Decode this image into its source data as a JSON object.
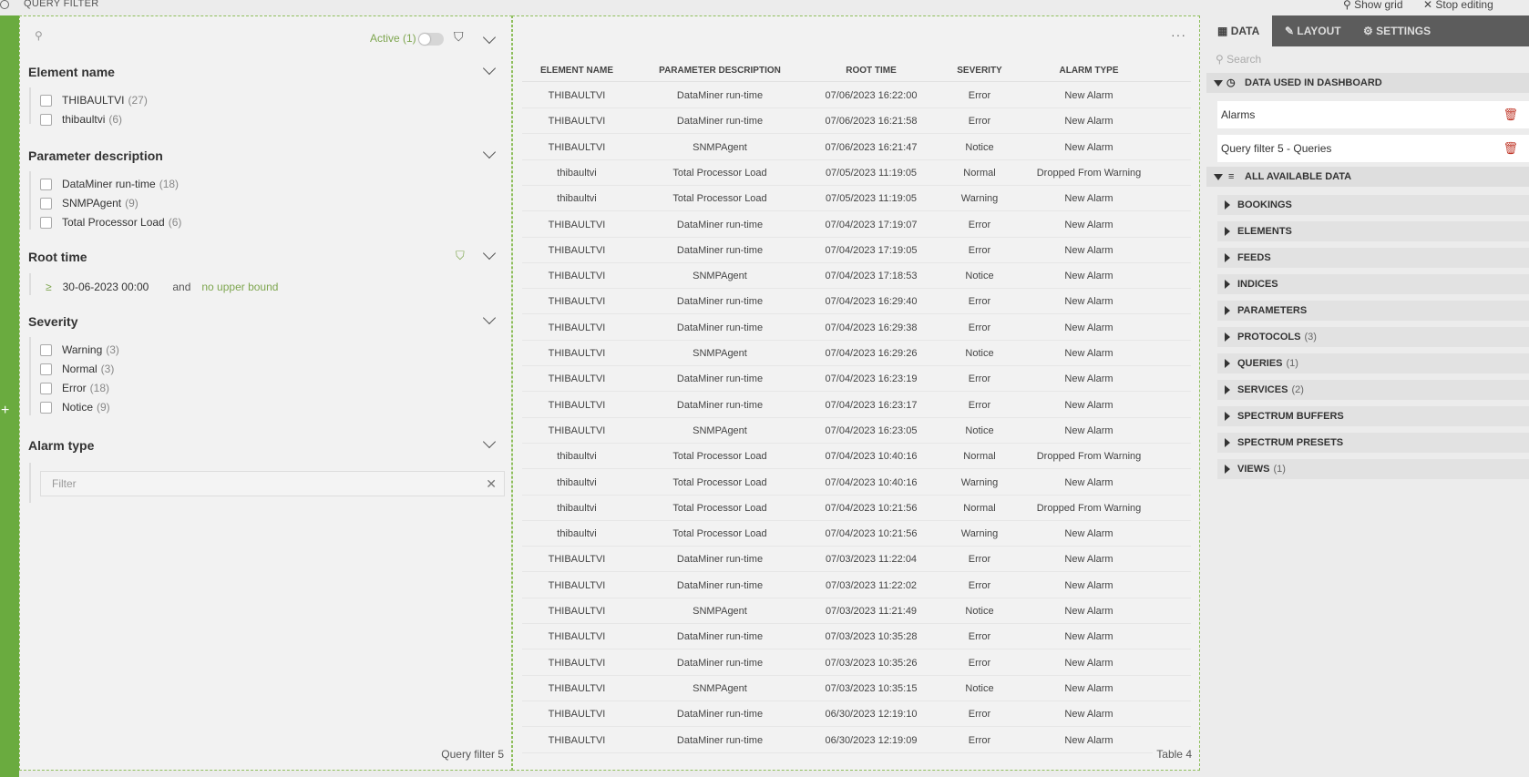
{
  "topbar": {
    "title": "QUERY FILTER",
    "show_grid": "Show grid",
    "stop_editing": "Stop editing"
  },
  "query_filter": {
    "active_label": "Active (1)",
    "sections": {
      "element_name": {
        "title": "Element name",
        "options": [
          {
            "label": "THIBAULTVI",
            "count": "(27)"
          },
          {
            "label": "thibaultvi",
            "count": "(6)"
          }
        ]
      },
      "parameter_description": {
        "title": "Parameter description",
        "options": [
          {
            "label": "DataMiner run-time",
            "count": "(18)"
          },
          {
            "label": "SNMPAgent",
            "count": "(9)"
          },
          {
            "label": "Total Processor Load",
            "count": "(6)"
          }
        ]
      },
      "root_time": {
        "title": "Root time",
        "operator": "≥",
        "lower": "30-06-2023 00:00",
        "and": "and",
        "upper": "no upper bound"
      },
      "severity": {
        "title": "Severity",
        "options": [
          {
            "label": "Warning",
            "count": "(3)"
          },
          {
            "label": "Normal",
            "count": "(3)"
          },
          {
            "label": "Error",
            "count": "(18)"
          },
          {
            "label": "Notice",
            "count": "(9)"
          }
        ]
      },
      "alarm_type": {
        "title": "Alarm type",
        "filter_placeholder": "Filter"
      }
    },
    "component_label": "Query filter 5"
  },
  "table": {
    "headers": [
      "ELEMENT NAME",
      "PARAMETER DESCRIPTION",
      "ROOT TIME",
      "SEVERITY",
      "ALARM TYPE"
    ],
    "rows": [
      [
        "THIBAULTVI",
        "DataMiner run-time",
        "07/06/2023 16:22:00",
        "Error",
        "New Alarm"
      ],
      [
        "THIBAULTVI",
        "DataMiner run-time",
        "07/06/2023 16:21:58",
        "Error",
        "New Alarm"
      ],
      [
        "THIBAULTVI",
        "SNMPAgent",
        "07/06/2023 16:21:47",
        "Notice",
        "New Alarm"
      ],
      [
        "thibaultvi",
        "Total Processor Load",
        "07/05/2023 11:19:05",
        "Normal",
        "Dropped From Warning"
      ],
      [
        "thibaultvi",
        "Total Processor Load",
        "07/05/2023 11:19:05",
        "Warning",
        "New Alarm"
      ],
      [
        "THIBAULTVI",
        "DataMiner run-time",
        "07/04/2023 17:19:07",
        "Error",
        "New Alarm"
      ],
      [
        "THIBAULTVI",
        "DataMiner run-time",
        "07/04/2023 17:19:05",
        "Error",
        "New Alarm"
      ],
      [
        "THIBAULTVI",
        "SNMPAgent",
        "07/04/2023 17:18:53",
        "Notice",
        "New Alarm"
      ],
      [
        "THIBAULTVI",
        "DataMiner run-time",
        "07/04/2023 16:29:40",
        "Error",
        "New Alarm"
      ],
      [
        "THIBAULTVI",
        "DataMiner run-time",
        "07/04/2023 16:29:38",
        "Error",
        "New Alarm"
      ],
      [
        "THIBAULTVI",
        "SNMPAgent",
        "07/04/2023 16:29:26",
        "Notice",
        "New Alarm"
      ],
      [
        "THIBAULTVI",
        "DataMiner run-time",
        "07/04/2023 16:23:19",
        "Error",
        "New Alarm"
      ],
      [
        "THIBAULTVI",
        "DataMiner run-time",
        "07/04/2023 16:23:17",
        "Error",
        "New Alarm"
      ],
      [
        "THIBAULTVI",
        "SNMPAgent",
        "07/04/2023 16:23:05",
        "Notice",
        "New Alarm"
      ],
      [
        "thibaultvi",
        "Total Processor Load",
        "07/04/2023 10:40:16",
        "Normal",
        "Dropped From Warning"
      ],
      [
        "thibaultvi",
        "Total Processor Load",
        "07/04/2023 10:40:16",
        "Warning",
        "New Alarm"
      ],
      [
        "thibaultvi",
        "Total Processor Load",
        "07/04/2023 10:21:56",
        "Normal",
        "Dropped From Warning"
      ],
      [
        "thibaultvi",
        "Total Processor Load",
        "07/04/2023 10:21:56",
        "Warning",
        "New Alarm"
      ],
      [
        "THIBAULTVI",
        "DataMiner run-time",
        "07/03/2023 11:22:04",
        "Error",
        "New Alarm"
      ],
      [
        "THIBAULTVI",
        "DataMiner run-time",
        "07/03/2023 11:22:02",
        "Error",
        "New Alarm"
      ],
      [
        "THIBAULTVI",
        "SNMPAgent",
        "07/03/2023 11:21:49",
        "Notice",
        "New Alarm"
      ],
      [
        "THIBAULTVI",
        "DataMiner run-time",
        "07/03/2023 10:35:28",
        "Error",
        "New Alarm"
      ],
      [
        "THIBAULTVI",
        "DataMiner run-time",
        "07/03/2023 10:35:26",
        "Error",
        "New Alarm"
      ],
      [
        "THIBAULTVI",
        "SNMPAgent",
        "07/03/2023 10:35:15",
        "Notice",
        "New Alarm"
      ],
      [
        "THIBAULTVI",
        "DataMiner run-time",
        "06/30/2023 12:19:10",
        "Error",
        "New Alarm"
      ],
      [
        "THIBAULTVI",
        "DataMiner run-time",
        "06/30/2023 12:19:09",
        "Error",
        "New Alarm"
      ]
    ],
    "component_label": "Table 4"
  },
  "right_pane": {
    "tabs": [
      "DATA",
      "LAYOUT",
      "SETTINGS"
    ],
    "search_placeholder": "Search",
    "data_used_title": "DATA USED IN DASHBOARD",
    "data_used": [
      "Alarms",
      "Query filter 5 - Queries"
    ],
    "all_available_title": "ALL AVAILABLE DATA",
    "categories": [
      {
        "label": "BOOKINGS",
        "count": ""
      },
      {
        "label": "ELEMENTS",
        "count": ""
      },
      {
        "label": "FEEDS",
        "count": ""
      },
      {
        "label": "INDICES",
        "count": ""
      },
      {
        "label": "PARAMETERS",
        "count": ""
      },
      {
        "label": "PROTOCOLS",
        "count": "(3)"
      },
      {
        "label": "QUERIES",
        "count": "(1)"
      },
      {
        "label": "SERVICES",
        "count": "(2)"
      },
      {
        "label": "SPECTRUM BUFFERS",
        "count": ""
      },
      {
        "label": "SPECTRUM PRESETS",
        "count": ""
      },
      {
        "label": "VIEWS",
        "count": "(1)"
      }
    ]
  }
}
